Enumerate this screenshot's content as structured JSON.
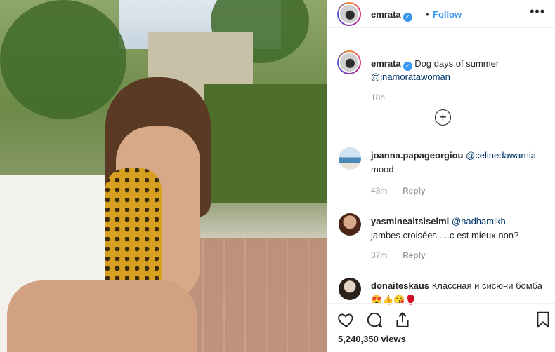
{
  "post": {
    "username": "emrata",
    "follow_label": "Follow",
    "dot": "•",
    "more_label": "•••",
    "caption_text": "Dog days of summer",
    "caption_mention": "@inamoratawoman",
    "caption_time": "18h",
    "load_more": "+"
  },
  "comments": [
    {
      "username": "joanna.papageorgiou",
      "mention": "@celinedawarnia",
      "text": "mood",
      "time": "43m",
      "reply": "Reply"
    },
    {
      "username": "yasmineaitsiselmi",
      "mention": "@hadhamikh",
      "text": "jambes croisées.....c est mieux non?",
      "time": "37m",
      "reply": "Reply"
    },
    {
      "username": "donaiteskaus",
      "text": "Классная и сисюни бомба😍👍😘🥊"
    }
  ],
  "views": "5,240,350 views",
  "icons": [
    "heart-icon",
    "comment-icon",
    "share-icon",
    "bookmark-icon",
    "verified-badge-icon",
    "more-icon"
  ]
}
